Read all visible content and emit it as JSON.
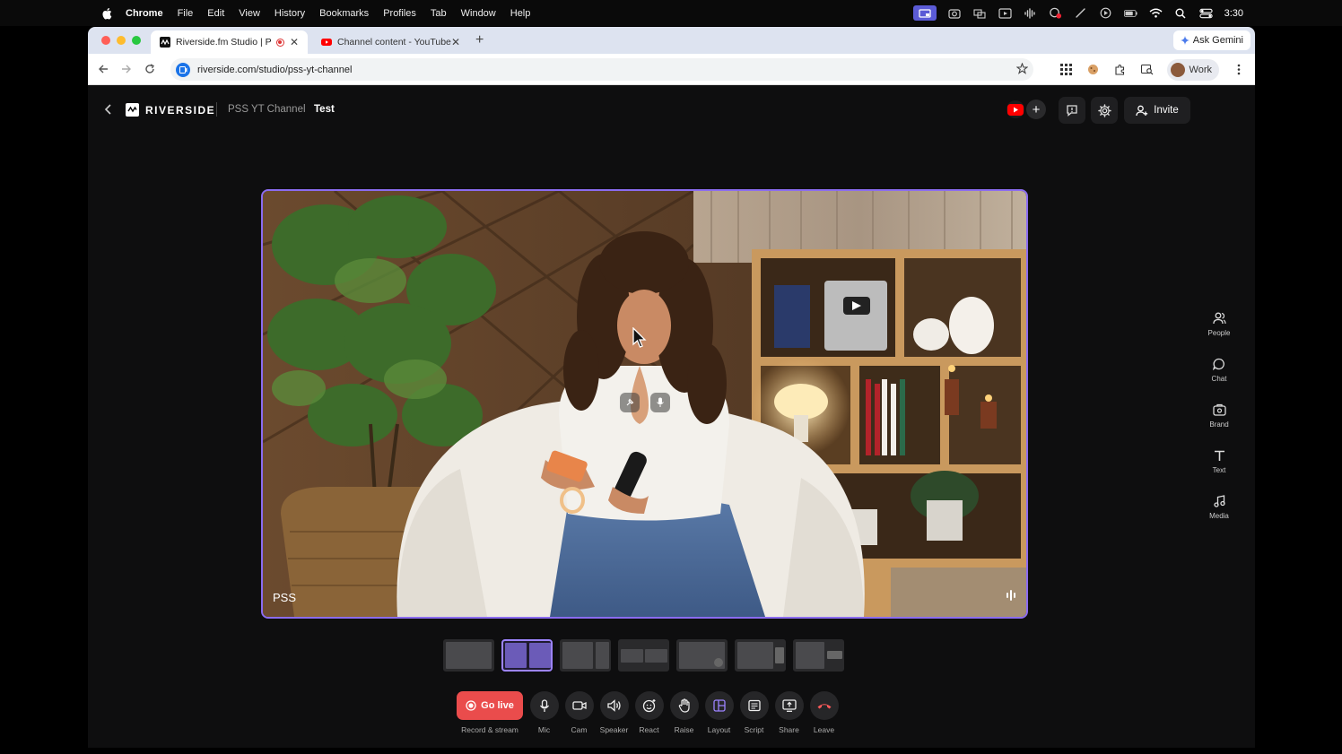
{
  "menubar": {
    "app": "Chrome",
    "items": [
      "File",
      "Edit",
      "View",
      "History",
      "Bookmarks",
      "Profiles",
      "Tab",
      "Window",
      "Help"
    ],
    "clock": "3:30"
  },
  "browser": {
    "tabs": [
      {
        "title": "Riverside.fm Studio | PSS",
        "active": true
      },
      {
        "title": "Channel content - YouTube Studio",
        "active": false
      }
    ],
    "gemini_label": "Ask Gemini",
    "url": "riverside.com/studio/pss-yt-channel",
    "profile_label": "Work"
  },
  "app": {
    "brand": "RIVERSIDE",
    "breadcrumb": [
      "PSS YT Channel",
      "Test"
    ],
    "invite_label": "Invite"
  },
  "stage": {
    "participant_name": "PSS"
  },
  "side_panel": [
    {
      "label": "People",
      "icon": "people-icon"
    },
    {
      "label": "Chat",
      "icon": "chat-icon"
    },
    {
      "label": "Brand",
      "icon": "brand-icon"
    },
    {
      "label": "Text",
      "icon": "text-icon"
    },
    {
      "label": "Media",
      "icon": "music-note-icon"
    }
  ],
  "controls": {
    "go_live": "Go live",
    "go_live_sub": "Record & stream",
    "buttons": [
      {
        "label": "Mic",
        "icon": "mic-icon"
      },
      {
        "label": "Cam",
        "icon": "camera-icon"
      },
      {
        "label": "Speaker",
        "icon": "speaker-icon"
      },
      {
        "label": "React",
        "icon": "emoji-icon"
      },
      {
        "label": "Raise",
        "icon": "hand-icon"
      },
      {
        "label": "Layout",
        "icon": "layout-icon"
      },
      {
        "label": "Script",
        "icon": "script-icon"
      },
      {
        "label": "Share",
        "icon": "share-screen-icon"
      },
      {
        "label": "Leave",
        "icon": "leave-phone-icon"
      }
    ]
  },
  "colors": {
    "accent": "#8b6cf0",
    "go_live": "#ea4c4c",
    "leave": "#ff5a5a"
  }
}
